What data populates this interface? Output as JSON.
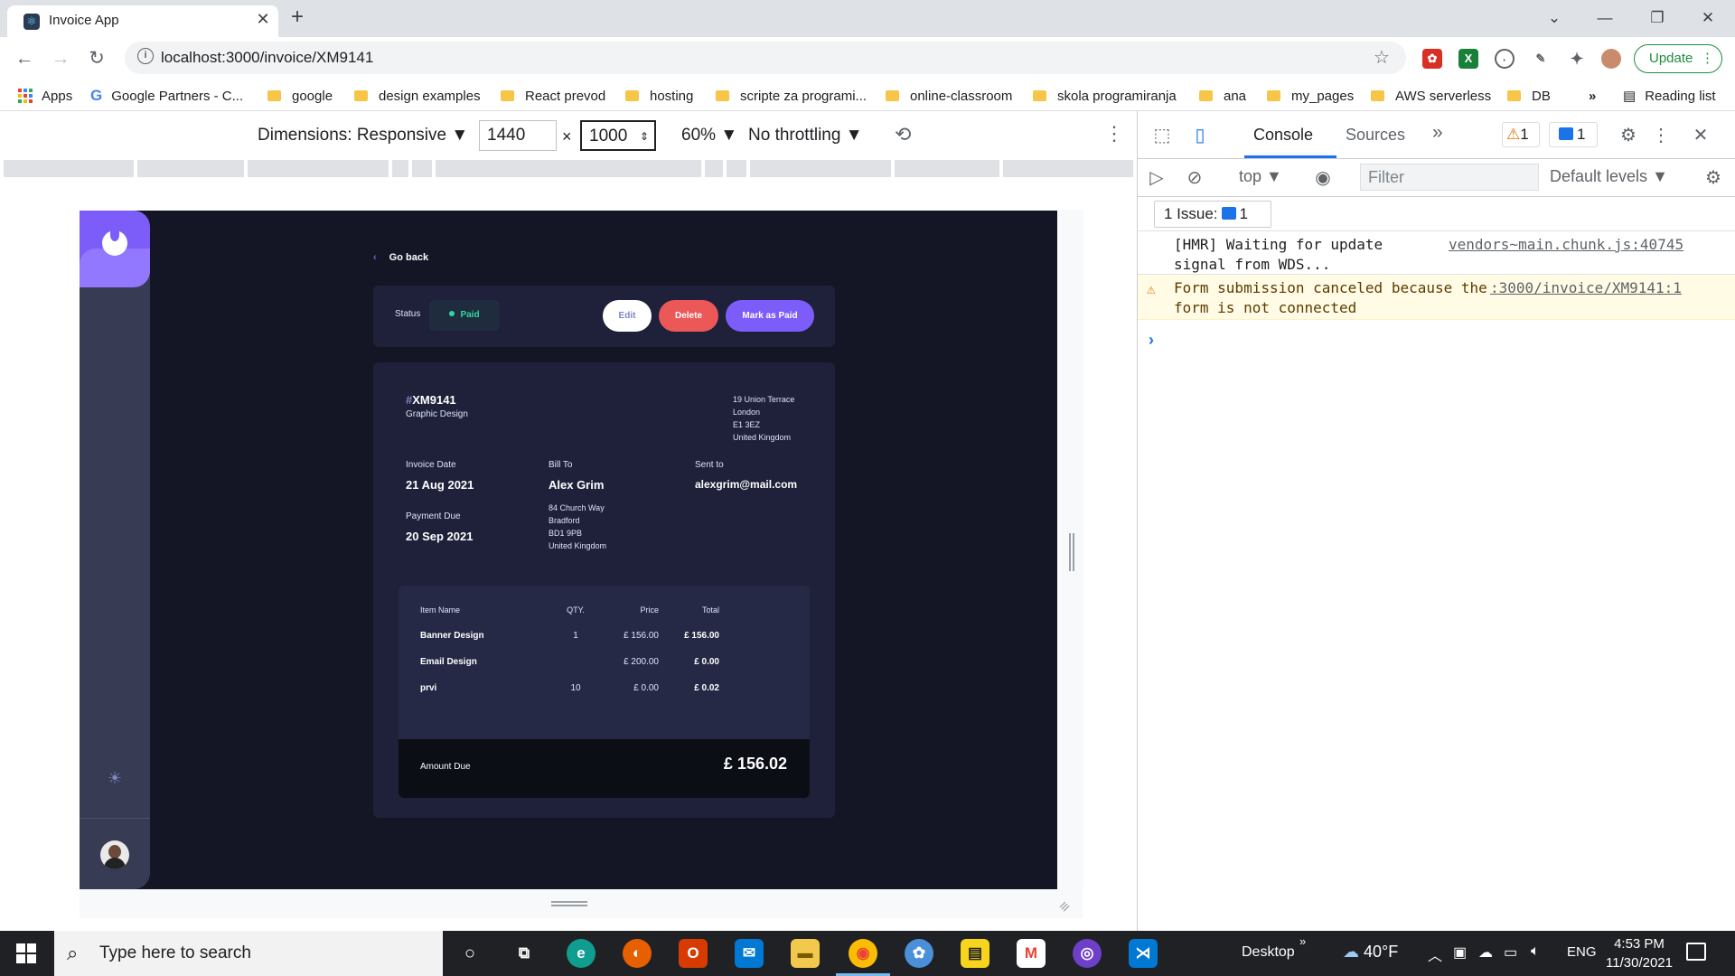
{
  "browser": {
    "tab_title": "Invoice App",
    "url": "localhost:3000/invoice/XM9141",
    "update_label": "Update",
    "bookmarks": [
      "Apps",
      "Google Partners - C...",
      "google",
      "design examples",
      "React prevod",
      "hosting",
      "scripte za programi...",
      "online-classroom",
      "skola programiranja",
      "ana",
      "my_pages",
      "AWS serverless",
      "DB"
    ],
    "reading_list": "Reading list"
  },
  "device_toolbar": {
    "dimensions_label": "Dimensions: Responsive",
    "width": "1440",
    "height": "1000",
    "zoom": "60%",
    "throttling": "No throttling"
  },
  "invoice": {
    "go_back": "Go back",
    "status_label": "Status",
    "status_value": "Paid",
    "edit_label": "Edit",
    "delete_label": "Delete",
    "mark_paid_label": "Mark as Paid",
    "id": "XM9141",
    "description": "Graphic Design",
    "sender_address": [
      "19 Union Terrace",
      "London",
      "E1 3EZ",
      "United Kingdom"
    ],
    "invoice_date_label": "Invoice Date",
    "invoice_date": "21 Aug 2021",
    "payment_due_label": "Payment Due",
    "payment_due": "20 Sep 2021",
    "bill_to_label": "Bill To",
    "client_name": "Alex Grim",
    "client_address": [
      "84 Church Way",
      "Bradford",
      "BD1 9PB",
      "United Kingdom"
    ],
    "sent_to_label": "Sent to",
    "client_email": "alexgrim@mail.com",
    "items_headers": {
      "name": "Item Name",
      "qty": "QTY.",
      "price": "Price",
      "total": "Total"
    },
    "items": [
      {
        "name": "Banner Design",
        "qty": "1",
        "price": "£ 156.00",
        "total": "£ 156.00"
      },
      {
        "name": "Email Design",
        "qty": "",
        "price": "£ 200.00",
        "total": "£ 0.00"
      },
      {
        "name": "prvi",
        "qty": "10",
        "price": "£ 0.00",
        "total": "£ 0.02"
      }
    ],
    "amount_due_label": "Amount Due",
    "amount_due": "£ 156.02"
  },
  "devtools": {
    "tab_console": "Console",
    "tab_sources": "Sources",
    "warning_count": "1",
    "message_count": "1",
    "context": "top",
    "filter_placeholder": "Filter",
    "levels": "Default levels",
    "issues_label": "1 Issue:",
    "issues_count": "1",
    "logs": [
      {
        "text": "[HMR] Waiting for update signal from WDS...",
        "source": "vendors~main.chunk.js:40745"
      },
      {
        "text": "Form submission canceled because the form is not connected",
        "source": ":3000/invoice/XM9141:1"
      }
    ]
  },
  "taskbar": {
    "search_placeholder": "Type here to search",
    "desktop_label": "Desktop",
    "temperature": "40°F",
    "language": "ENG",
    "time": "4:53 PM",
    "date": "11/30/2021"
  },
  "colors": {
    "accent": "#7c5dfa",
    "paid_green": "#33d69f",
    "delete_red": "#ec5757",
    "app_bg": "#141625",
    "card_bg": "#1e2139"
  }
}
